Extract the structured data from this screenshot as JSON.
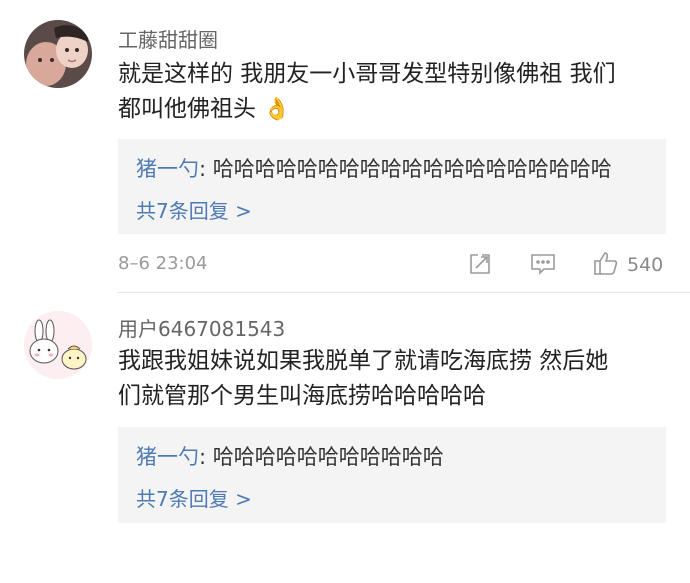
{
  "comments": [
    {
      "username": "工藤甜甜圈",
      "text_lines": [
        "就是这样的 我朋友一小哥哥发型特别像佛祖 我们",
        "都叫他佛祖头"
      ],
      "emoji": "👌",
      "reply": {
        "name": "猪一勺",
        "separator": ":",
        "text": "哈哈哈哈哈哈哈哈哈哈哈哈哈哈哈哈哈哈哈",
        "more": "共7条回复 >"
      },
      "timestamp": "8–6 23:04",
      "likes": "540"
    },
    {
      "username": "用户6467081543",
      "text_lines": [
        "我跟我姐妹说如果我脱单了就请吃海底捞 然后她",
        "们就管那个男生叫海底捞哈哈哈哈哈"
      ],
      "reply": {
        "name": "猪一勺",
        "separator": ":",
        "text": "哈哈哈哈哈哈哈哈哈哈哈",
        "more": "共7条回复 >"
      }
    }
  ],
  "colors": {
    "link": "#4e7ab3",
    "reply_bg": "#f4f4f4",
    "meta": "#9a9a9a"
  },
  "icons": [
    "share-icon",
    "comment-icon",
    "like-icon"
  ]
}
